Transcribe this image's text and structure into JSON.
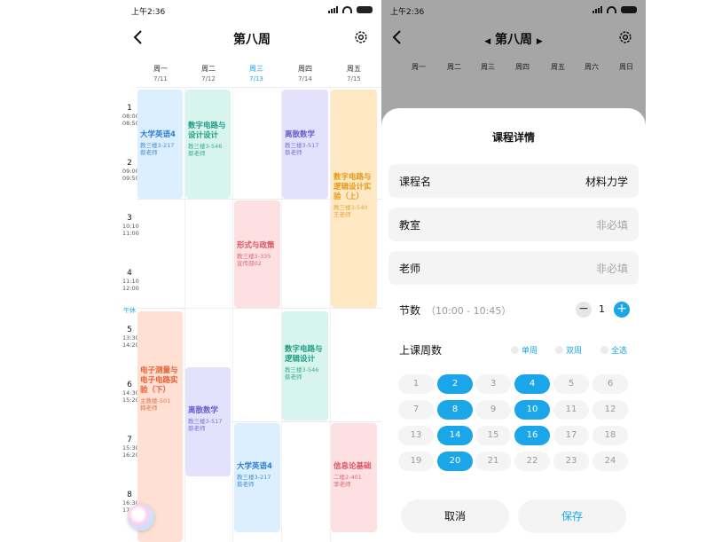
{
  "status": {
    "time": "上午2:36"
  },
  "schedule": {
    "title": "第八周",
    "days": [
      {
        "name": "周一",
        "date": "7/11"
      },
      {
        "name": "周二",
        "date": "7/12"
      },
      {
        "name": "周三",
        "date": "7/13"
      },
      {
        "name": "周四",
        "date": "7/14"
      },
      {
        "name": "周五",
        "date": "7/15"
      }
    ],
    "periods": [
      {
        "n": "1",
        "start": "08:00",
        "end": "08:50"
      },
      {
        "n": "2",
        "start": "09:00",
        "end": "09:50"
      },
      {
        "n": "3",
        "start": "10:10",
        "end": "11:00"
      },
      {
        "n": "4",
        "start": "11:10",
        "end": "12:00"
      },
      {
        "n": "5",
        "start": "13:30",
        "end": "14:20"
      },
      {
        "n": "6",
        "start": "14:30",
        "end": "15:20"
      },
      {
        "n": "7",
        "start": "15:30",
        "end": "16:20"
      },
      {
        "n": "8",
        "start": "16:30",
        "end": "17:20"
      }
    ],
    "noon_label": "午休",
    "courses": [
      {
        "name": "大学英语4",
        "room": "教三楼3-217",
        "teacher": "蔡老师",
        "color": "blue"
      },
      {
        "name": "数字电路与设计设计",
        "room": "教三楼3-546",
        "teacher": "蔡老师",
        "color": "green"
      },
      {
        "name": "离散数学",
        "room": "教三楼3-517",
        "teacher": "蔡老师",
        "color": "purple"
      },
      {
        "name": "数字电路与逻辑设计实验（上）",
        "room": "教三楼3-540",
        "teacher": "王老师",
        "color": "orange"
      },
      {
        "name": "形式与政策",
        "room": "教三楼3-335",
        "teacher": "宣传部02",
        "color": "pink"
      },
      {
        "name": "数字电路与逻辑设计",
        "room": "教三楼3-546",
        "teacher": "蔡老师",
        "color": "green"
      },
      {
        "name": "电子测量与电子电路实验（下）",
        "room": "主教楼-501",
        "teacher": "韩老师",
        "color": "salmon"
      },
      {
        "name": "离散数学",
        "room": "教三楼3-517",
        "teacher": "蔡老师",
        "color": "purple"
      },
      {
        "name": "大学英语4",
        "room": "教三楼3-217",
        "teacher": "蔡老师",
        "color": "blue"
      },
      {
        "name": "信息论基础",
        "room": "二楼2-401",
        "teacher": "李老师",
        "color": "pink"
      }
    ]
  },
  "detail_page": {
    "title": "第八周",
    "days": [
      "周一",
      "周二",
      "周三",
      "周四",
      "周五",
      "周六",
      "周日"
    ]
  },
  "detail": {
    "title": "课程详情",
    "course_name_label": "课程名",
    "course_name_value": "材料力学",
    "room_label": "教室",
    "room_placeholder": "非必填",
    "teacher_label": "老师",
    "teacher_placeholder": "非必填",
    "sections_label": "节数",
    "sections_time": "（10:00 - 10:45）",
    "sections_value": "1",
    "weeks_label": "上课周数",
    "radio_odd": "单周",
    "radio_even": "双周",
    "radio_all": "全选",
    "weeks": [
      "1",
      "2",
      "3",
      "4",
      "5",
      "6",
      "7",
      "8",
      "9",
      "10",
      "11",
      "12",
      "13",
      "14",
      "15",
      "16",
      "17",
      "18",
      "19",
      "20",
      "21",
      "22",
      "23",
      "24"
    ],
    "selected_weeks": [
      "2",
      "4",
      "8",
      "10",
      "14",
      "16",
      "20"
    ],
    "cancel": "取消",
    "save": "保存"
  },
  "colors": {
    "accent": "#1aa6e8"
  }
}
